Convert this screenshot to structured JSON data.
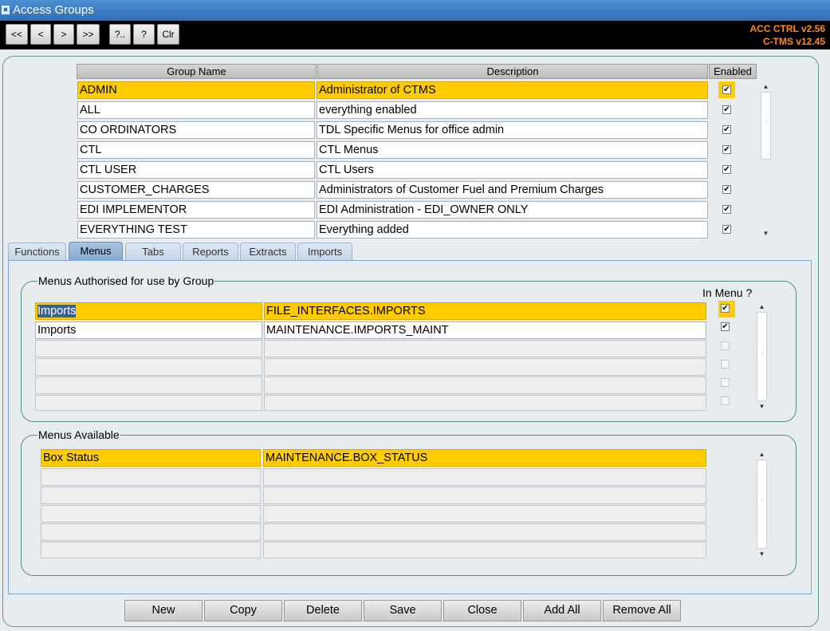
{
  "window": {
    "title": "Access Groups"
  },
  "toolbar": {
    "buttons": [
      "<<",
      "<",
      ">",
      ">>",
      "?..",
      "?",
      "Clr"
    ],
    "version_line1": "ACC  CTRL v2.56",
    "version_line2": "C-TMS v12.45",
    "version_color": "#ff8c1a"
  },
  "groups_table": {
    "headers": {
      "group_name": "Group Name",
      "description": "Description",
      "enabled": "Enabled"
    },
    "rows": [
      {
        "name": "ADMIN",
        "description": "Administrator of CTMS",
        "enabled": true,
        "selected": true
      },
      {
        "name": "ALL",
        "description": "everything enabled",
        "enabled": true,
        "selected": false
      },
      {
        "name": "CO ORDINATORS",
        "description": "TDL Specific Menus for office admin",
        "enabled": true,
        "selected": false
      },
      {
        "name": "CTL",
        "description": "CTL Menus",
        "enabled": true,
        "selected": false
      },
      {
        "name": "CTL USER",
        "description": "CTL Users",
        "enabled": true,
        "selected": false
      },
      {
        "name": "CUSTOMER_CHARGES",
        "description": "Administrators of Customer Fuel and Premium Charges",
        "enabled": true,
        "selected": false
      },
      {
        "name": "EDI IMPLEMENTOR",
        "description": "EDI Administration - EDI_OWNER ONLY",
        "enabled": true,
        "selected": false
      },
      {
        "name": "EVERYTHING TEST",
        "description": "Everything added",
        "enabled": true,
        "selected": false
      }
    ]
  },
  "tabs": [
    {
      "label": "Functions",
      "active": false
    },
    {
      "label": "Menus",
      "active": true
    },
    {
      "label": "Tabs",
      "active": false
    },
    {
      "label": "Reports",
      "active": false
    },
    {
      "label": "Extracts",
      "active": false
    },
    {
      "label": "Imports",
      "active": false
    }
  ],
  "authorised_menus": {
    "title": "Menus Authorised for use by Group",
    "in_menu_header": "In Menu ?",
    "rows": [
      {
        "name": "Imports",
        "menu": "FILE_INTERFACES.IMPORTS",
        "in_menu": true,
        "selected": true
      },
      {
        "name": "Imports",
        "menu": "MAINTENANCE.IMPORTS_MAINT",
        "in_menu": true,
        "selected": false
      },
      {
        "name": "",
        "menu": "",
        "in_menu": false,
        "selected": false
      },
      {
        "name": "",
        "menu": "",
        "in_menu": false,
        "selected": false
      },
      {
        "name": "",
        "menu": "",
        "in_menu": false,
        "selected": false
      },
      {
        "name": "",
        "menu": "",
        "in_menu": false,
        "selected": false
      }
    ]
  },
  "available_menus": {
    "title": "Menus Available",
    "rows": [
      {
        "name": "Box Status",
        "menu": "MAINTENANCE.BOX_STATUS",
        "selected": true
      },
      {
        "name": "",
        "menu": "",
        "selected": false
      },
      {
        "name": "",
        "menu": "",
        "selected": false
      },
      {
        "name": "",
        "menu": "",
        "selected": false
      },
      {
        "name": "",
        "menu": "",
        "selected": false
      },
      {
        "name": "",
        "menu": "",
        "selected": false
      }
    ]
  },
  "actions": {
    "new": "New",
    "copy": "Copy",
    "delete": "Delete",
    "save": "Save",
    "close": "Close",
    "add_all": "Add All",
    "remove_all": "Remove All"
  },
  "colors": {
    "selection": "#ffcc00",
    "titlebar": "#2e6fb6",
    "toolbar": "#000000"
  },
  "icons": {
    "scroll_up": "triangle-up-icon",
    "scroll_down": "triangle-down-icon",
    "check": "check-icon"
  }
}
